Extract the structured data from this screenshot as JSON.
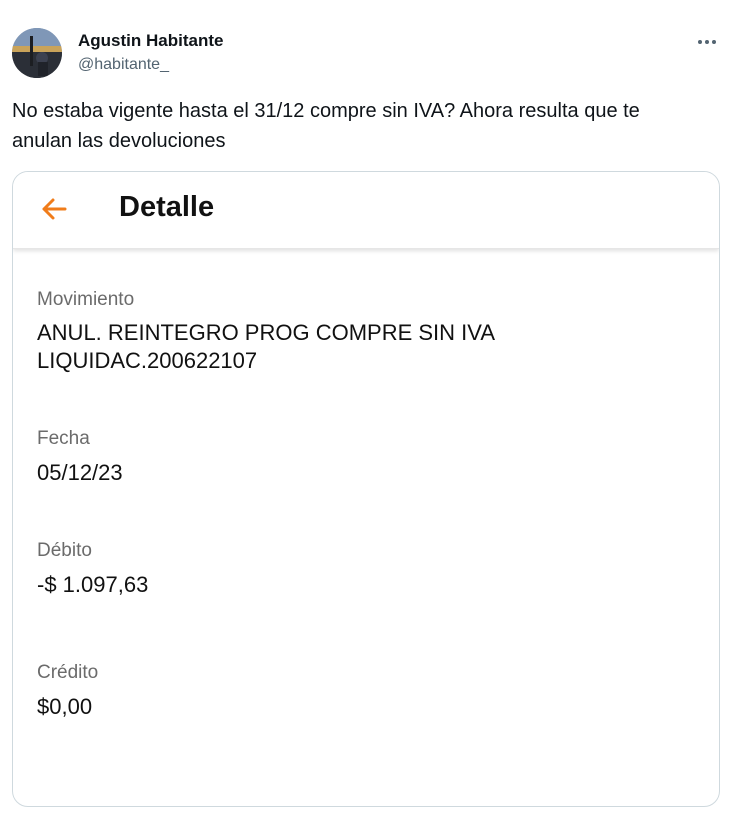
{
  "author": {
    "name": "Agustin Habitante",
    "handle": "@habitante_"
  },
  "more_icon": "ellipsis-icon",
  "tweet": {
    "text_line1": "No estaba vigente hasta el 31/12 compre sin IVA? Ahora resulta que te",
    "text_line2": "anulan las devoluciones"
  },
  "card": {
    "header": {
      "back_icon": "arrow-left-icon",
      "title": "Detalle",
      "accent_color": "#f07c1a"
    },
    "fields": [
      {
        "label": "Movimiento",
        "value_line1": "ANUL. REINTEGRO PROG COMPRE SIN IVA",
        "value_line2": "LIQUIDAC.200622107"
      },
      {
        "label": "Fecha",
        "value": "05/12/23"
      },
      {
        "label": "Débito",
        "value": "-$ 1.097,63"
      },
      {
        "label": "Crédito",
        "value": "$0,00"
      }
    ]
  }
}
